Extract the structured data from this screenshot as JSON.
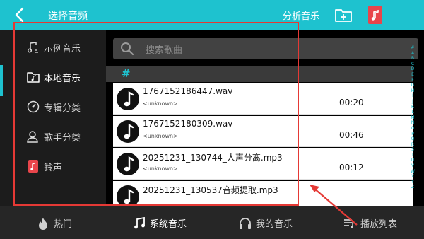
{
  "topbar": {
    "title": "选择音频",
    "analyze_label": "分析音乐"
  },
  "sidebar": {
    "items": [
      {
        "label": "示例音乐",
        "icon": "music-notes-icon"
      },
      {
        "label": "本地音乐",
        "icon": "folder-music-icon"
      },
      {
        "label": "专辑分类",
        "icon": "album-disc-icon"
      },
      {
        "label": "歌手分类",
        "icon": "singer-icon"
      },
      {
        "label": "铃声",
        "icon": "ringtone-icon"
      }
    ],
    "active": "本地音乐"
  },
  "search": {
    "placeholder": "搜索歌曲"
  },
  "section": {
    "letter": "#"
  },
  "songs": [
    {
      "name": "1767152186447.wav",
      "artist": "<unknown>",
      "duration": "00:20"
    },
    {
      "name": "1767152180309.wav",
      "artist": "<unknown>",
      "duration": "00:46"
    },
    {
      "name": "20251231_130744_人声分离.mp3",
      "artist": "<unknown>",
      "duration": "00:12"
    },
    {
      "name": "20251231_130537音频提取.mp3",
      "artist": "",
      "duration": ""
    }
  ],
  "alphabet": [
    "#",
    "A",
    "B",
    "C",
    "D",
    "E",
    "F",
    "G",
    "H",
    "I",
    "J",
    "K",
    "L",
    "M",
    "N",
    "O",
    "P",
    "Q",
    "R",
    "S",
    "T",
    "U",
    "V",
    "W",
    "X",
    "Y",
    "Z"
  ],
  "bottom_tabs": [
    {
      "label": "热门",
      "icon": "flame-icon"
    },
    {
      "label": "系统音乐",
      "icon": "music-note-icon"
    },
    {
      "label": "我的音乐",
      "icon": "headphones-icon"
    },
    {
      "label": "播放列表",
      "icon": "playlist-icon"
    }
  ],
  "bottom_active": "系统音乐",
  "colors": {
    "accent": "#1ec2cf",
    "annotation": "#e53935",
    "ringtone_icon": "#e8454b"
  }
}
